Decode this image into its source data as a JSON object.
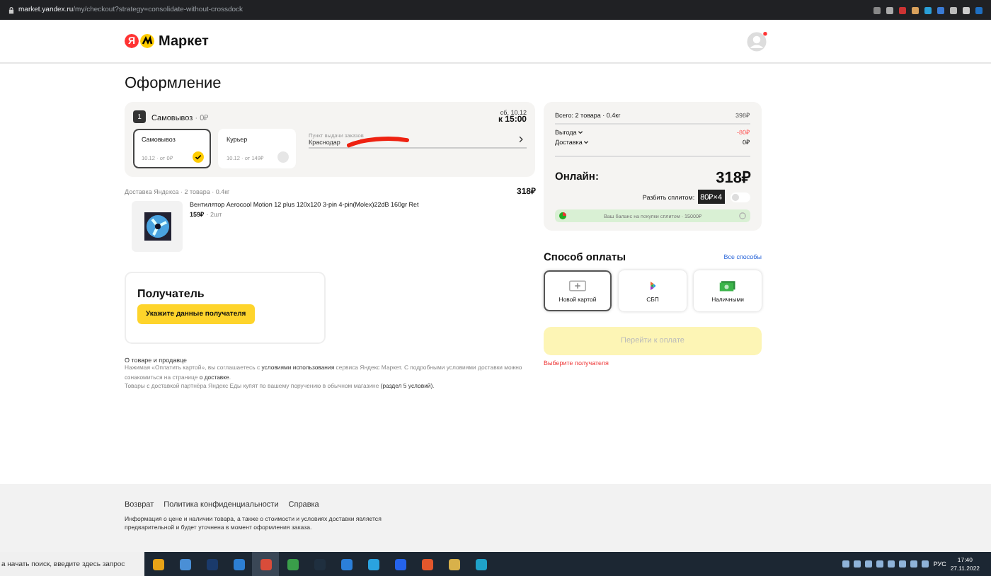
{
  "browser": {
    "url_host": "market.yandex.ru",
    "url_path": "/my/checkout?strategy=consolidate-without-crossdock"
  },
  "header": {
    "logo_mark": "Я",
    "logo_text": "Маркет"
  },
  "page_title": "Оформление",
  "shipment": {
    "number": "1",
    "title": "Самовывоз",
    "price": " · 0₽",
    "date": "сб, 10.12",
    "time": "к 15:00",
    "options": [
      {
        "label": "Самовывоз",
        "detail": "10.12 · от 0₽",
        "selected": true
      },
      {
        "label": "Курьер",
        "detail": "10.12 · от 149₽",
        "selected": false
      }
    ],
    "pickup": {
      "label": "Пункт выдачи заказов",
      "address": "Краснодар"
    },
    "delivery_info": "Доставка Яндекса · 2 товара · 0.4кг",
    "delivery_total": "318₽",
    "product": {
      "name": "Вентилятор Aerocool Motion 12 plus 120x120 3-pin 4-pin(Molex)22dB 160gr Ret",
      "price": "159₽",
      "qty": " · 2шт"
    }
  },
  "summary": {
    "rows": [
      {
        "kind": "total",
        "label": "Всего: 2 товара · 0.4кг",
        "value": "398₽"
      },
      {
        "kind": "discount",
        "label": "Выгода",
        "value": "-80₽"
      },
      {
        "kind": "delivery",
        "label": "Доставка",
        "value": "0₽"
      }
    ],
    "online_label": "Онлайн:",
    "online_total": "318₽",
    "split_label": "Разбить сплитом:",
    "split_badge": "80₽×4",
    "split_on": false,
    "balance": "Ваш баланс на покупки сплитом · 15000₽"
  },
  "payment": {
    "title": "Способ оплаты",
    "all_link": "Все способы",
    "methods": [
      {
        "kind": "card",
        "label": "Новой картой",
        "selected": true
      },
      {
        "kind": "sbp",
        "label": "СБП",
        "selected": false
      },
      {
        "kind": "cash",
        "label": "Наличными",
        "selected": false
      }
    ],
    "submit": "Перейти к оплате",
    "submit_disabled": true,
    "error": "Выберите получателя"
  },
  "recipient": {
    "title": "Получатель",
    "button": "Укажите данные получателя"
  },
  "legal": {
    "title": "О товаре и продавце",
    "paragraphs": [
      [
        {
          "kind": "text",
          "text": "Нажимая «Оплатить картой», вы соглашаетесь с "
        },
        {
          "kind": "link",
          "text": "условиями использования"
        },
        {
          "kind": "text",
          "text": " сервиса Яндекс Маркет. С подробными условиями доставки можно ознакомиться на странице "
        },
        {
          "kind": "link",
          "text": "о доставке"
        },
        {
          "kind": "text",
          "text": "."
        }
      ],
      [
        {
          "kind": "text",
          "text": "Товары с доставкой партнёра Яндекс Еды купят по вашему поручению в обычном магазине "
        },
        {
          "kind": "link",
          "text": "(раздел 5 условий)"
        },
        {
          "kind": "text",
          "text": "."
        }
      ]
    ]
  },
  "footer": {
    "links": [
      "Возврат",
      "Политика конфиденциальности",
      "Справка"
    ],
    "note": "Информация о цене и наличии товара, а также о стоимости и условиях доставки является предварительной и будет уточнена в момент оформления заказа."
  },
  "taskbar": {
    "search": "а начать поиск, введите здесь запрос",
    "lang": "РУС",
    "time": "17:40",
    "date": "27.11.2022"
  }
}
